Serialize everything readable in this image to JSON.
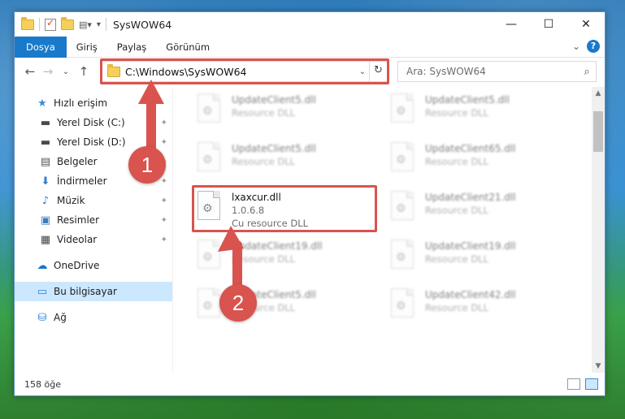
{
  "window": {
    "title": "SysWOW64",
    "buttons": {
      "minimize": "—",
      "maximize": "☐",
      "close": "✕"
    }
  },
  "ribbon": {
    "tabs": [
      "Dosya",
      "Giriş",
      "Paylaş",
      "Görünüm"
    ],
    "expand": "⌄",
    "help": "?"
  },
  "nav": {
    "back": "←",
    "forward": "→",
    "recent": "⌄",
    "up": "↑",
    "address": "C:\\Windows\\SysWOW64",
    "address_dropdown": "⌄",
    "refresh": "↻",
    "search_placeholder": "Ara: SysWOW64",
    "search_icon": "⌕"
  },
  "sidebar": {
    "items": [
      {
        "label": "Hızlı erişim",
        "icon": "star-icon",
        "glyph": "★",
        "color": "#3c8bd6",
        "pinned": false
      },
      {
        "label": "Yerel Disk (C:)",
        "icon": "drive-icon",
        "glyph": "▬",
        "color": "#4a4a4a",
        "pinned": true
      },
      {
        "label": "Yerel Disk (D:)",
        "icon": "drive-icon",
        "glyph": "▬",
        "color": "#4a4a4a",
        "pinned": true
      },
      {
        "label": "Belgeler",
        "icon": "document-icon",
        "glyph": "▤",
        "color": "#555",
        "pinned": true
      },
      {
        "label": "İndirmeler",
        "icon": "download-icon",
        "glyph": "⬇",
        "color": "#2f7fd1",
        "pinned": true
      },
      {
        "label": "Müzik",
        "icon": "music-icon",
        "glyph": "♪",
        "color": "#2f7fd1",
        "pinned": true
      },
      {
        "label": "Resimler",
        "icon": "pictures-icon",
        "glyph": "▣",
        "color": "#3b7bbf",
        "pinned": true
      },
      {
        "label": "Videolar",
        "icon": "video-icon",
        "glyph": "▦",
        "color": "#444",
        "pinned": true
      },
      {
        "label": "OneDrive",
        "icon": "cloud-icon",
        "glyph": "☁",
        "color": "#1a73c9",
        "pinned": false
      },
      {
        "label": "Bu bilgisayar",
        "icon": "computer-icon",
        "glyph": "▭",
        "color": "#2a7fd4",
        "pinned": false
      },
      {
        "label": "Ağ",
        "icon": "network-icon",
        "glyph": "⛁",
        "color": "#2a7fd4",
        "pinned": false
      }
    ],
    "pin_glyph": "📌"
  },
  "files": [
    {
      "name": "UpdateClient5.dll",
      "line2": "Resource DLL",
      "line3": ""
    },
    {
      "name": "UpdateClient5.dll",
      "line2": "Resource DLL",
      "line3": ""
    },
    {
      "name": "UpdateClient5.dll",
      "line2": "Resource DLL",
      "line3": ""
    },
    {
      "name": "UpdateClient65.dll",
      "line2": "Resource DLL",
      "line3": ""
    },
    {
      "name": "lxaxcur.dll",
      "line2": "1.0.6.8",
      "line3": "Cu resource DLL"
    },
    {
      "name": "UpdateClient21.dll",
      "line2": "Resource DLL",
      "line3": ""
    },
    {
      "name": "UpdateClient19.dll",
      "line2": "Resource DLL",
      "line3": ""
    },
    {
      "name": "UpdateClient19.dll",
      "line2": "Resource DLL",
      "line3": ""
    },
    {
      "name": "UpdateClient5.dll",
      "line2": "Resource DLL",
      "line3": ""
    },
    {
      "name": "UpdateClient42.dll",
      "line2": "Resource DLL",
      "line3": ""
    }
  ],
  "status": {
    "count": "158 öğe"
  },
  "annotations": {
    "step1": "1",
    "step2": "2",
    "color": "#d9534f"
  }
}
